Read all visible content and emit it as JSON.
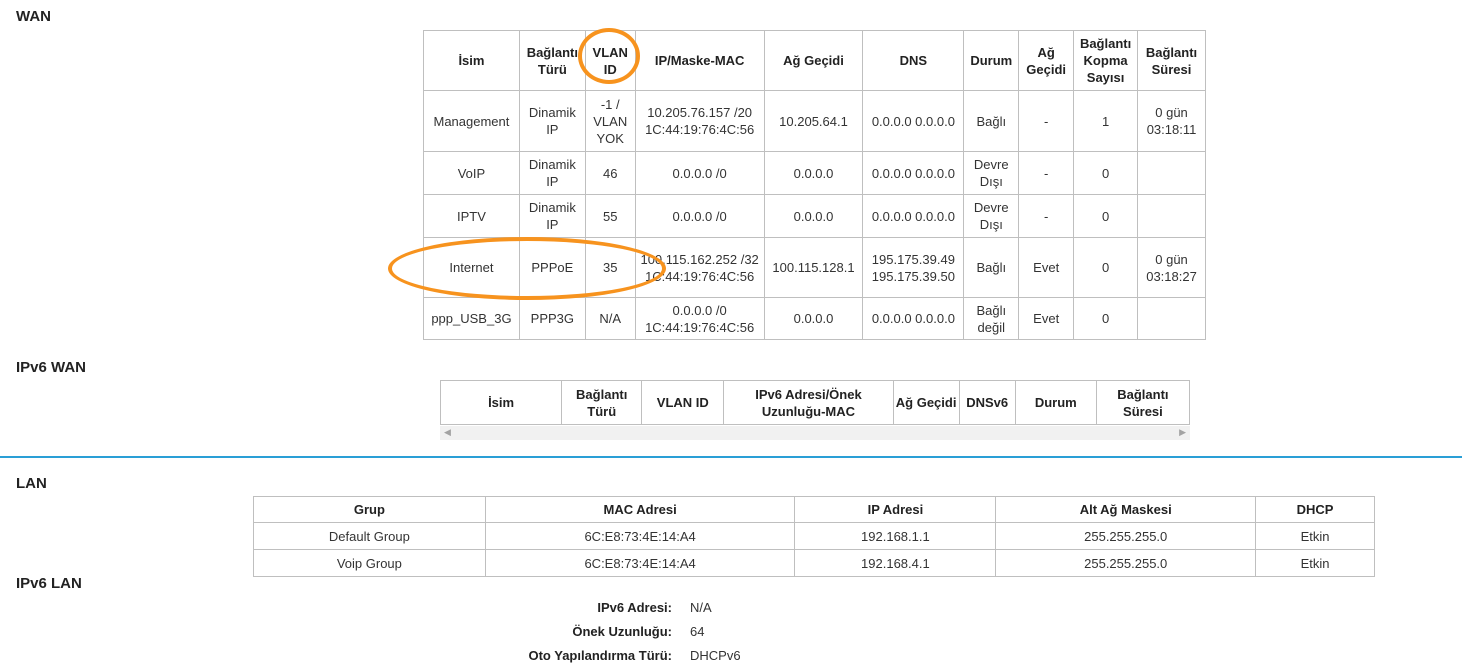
{
  "sections": {
    "wan": "WAN",
    "ipv6_wan": "IPv6 WAN",
    "lan": "LAN",
    "ipv6_lan": "IPv6 LAN"
  },
  "wan": {
    "headers": [
      "İsim",
      "Bağlantı Türü",
      "VLAN ID",
      "IP/Maske-MAC",
      "Ağ Geçidi",
      "DNS",
      "Durum",
      "Ağ Geçidi",
      "Bağlantı Kopma Sayısı",
      "Bağlantı Süresi"
    ],
    "rows": [
      [
        "Management",
        "Dinamik IP",
        "-1 / VLAN YOK",
        "10.205.76.157 /20 1C:44:19:76:4C:56",
        "10.205.64.1",
        "0.0.0.0 0.0.0.0",
        "Bağlı",
        "-",
        "1",
        "0 gün 03:18:11"
      ],
      [
        "VoIP",
        "Dinamik IP",
        "46",
        "0.0.0.0 /0",
        "0.0.0.0",
        "0.0.0.0 0.0.0.0",
        "Devre Dışı",
        "-",
        "0",
        ""
      ],
      [
        "IPTV",
        "Dinamik IP",
        "55",
        "0.0.0.0 /0",
        "0.0.0.0",
        "0.0.0.0 0.0.0.0",
        "Devre Dışı",
        "-",
        "0",
        ""
      ],
      [
        "Internet",
        "PPPoE",
        "35",
        "100.115.162.252 /32 1C:44:19:76:4C:56",
        "100.115.128.1",
        "195.175.39.49 195.175.39.50",
        "Bağlı",
        "Evet",
        "0",
        "0 gün 03:18:27"
      ],
      [
        "ppp_USB_3G",
        "PPP3G",
        "N/A",
        "0.0.0.0 /0 1C:44:19:76:4C:56",
        "0.0.0.0",
        "0.0.0.0 0.0.0.0",
        "Bağlı değil",
        "Evet",
        "0",
        ""
      ]
    ]
  },
  "ipv6_wan": {
    "headers": [
      "İsim",
      "Bağlantı Türü",
      "VLAN ID",
      "IPv6 Adresi/Önek Uzunluğu-MAC",
      "Ağ Geçidi",
      "DNSv6",
      "Durum",
      "Bağlantı Süresi"
    ]
  },
  "lan": {
    "headers": [
      "Grup",
      "MAC Adresi",
      "IP Adresi",
      "Alt Ağ Maskesi",
      "DHCP"
    ],
    "rows": [
      [
        "Default Group",
        "6C:E8:73:4E:14:A4",
        "192.168.1.1",
        "255.255.255.0",
        "Etkin"
      ],
      [
        "Voip Group",
        "6C:E8:73:4E:14:A4",
        "192.168.4.1",
        "255.255.255.0",
        "Etkin"
      ]
    ]
  },
  "ipv6_lan": {
    "address_label": "IPv6 Adresi:",
    "address_value": "N/A",
    "prefix_label": "Önek Uzunluğu:",
    "prefix_value": "64",
    "autoconf_label": "Oto Yapılandırma Türü:",
    "autoconf_value": "DHCPv6"
  },
  "colors": {
    "highlight": "#f7931e",
    "divider": "#2a9fd6"
  }
}
